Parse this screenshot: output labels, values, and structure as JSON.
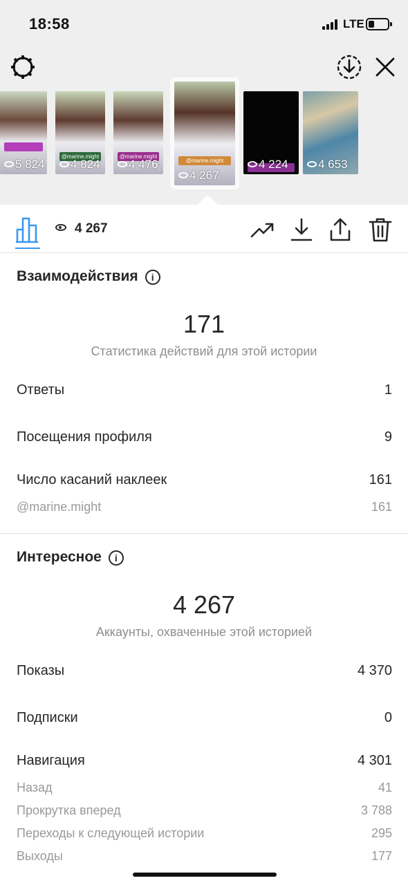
{
  "status_bar": {
    "time": "18:58",
    "network": "LTE"
  },
  "header": {
    "settings_icon": "gear-icon",
    "save_icon": "download-circle-icon",
    "close_icon": "close-icon"
  },
  "stories": [
    {
      "views": "5 824",
      "tag": ""
    },
    {
      "views": "4 824",
      "tag": "@marine.might"
    },
    {
      "views": "4 476",
      "tag": "@marine.might"
    },
    {
      "views": "4 267",
      "tag": "@marine.might",
      "active": true
    },
    {
      "views": "4 224",
      "tag": ""
    },
    {
      "views": "4 653",
      "tag": ""
    }
  ],
  "toolbar": {
    "view_count": "4 267",
    "icons": [
      "insights-bars-icon",
      "trending-icon",
      "download-icon",
      "share-icon",
      "trash-icon"
    ]
  },
  "interactions": {
    "title": "Взаимодействия",
    "total": "171",
    "caption": "Статистика действий для этой истории",
    "rows": [
      {
        "label": "Ответы",
        "value": "1"
      },
      {
        "label": "Посещения профиля",
        "value": "9"
      },
      {
        "label": "Число касаний наклеек",
        "value": "161"
      }
    ],
    "sub_rows": [
      {
        "label": "@marine.might",
        "value": "161"
      }
    ]
  },
  "discovery": {
    "title": "Интересное",
    "total": "4 267",
    "caption": "Аккаунты, охваченные этой историей",
    "rows": [
      {
        "label": "Показы",
        "value": "4 370"
      },
      {
        "label": "Подписки",
        "value": "0"
      },
      {
        "label": "Навигация",
        "value": "4 301"
      }
    ],
    "sub_rows": [
      {
        "label": "Назад",
        "value": "41"
      },
      {
        "label": "Прокрутка вперед",
        "value": "3 788"
      },
      {
        "label": "Переходы к следующей истории",
        "value": "295"
      },
      {
        "label": "Выходы",
        "value": "177"
      }
    ]
  },
  "colors": {
    "accent": "#3897f0",
    "text": "#262626",
    "muted": "#8e8e8e"
  }
}
